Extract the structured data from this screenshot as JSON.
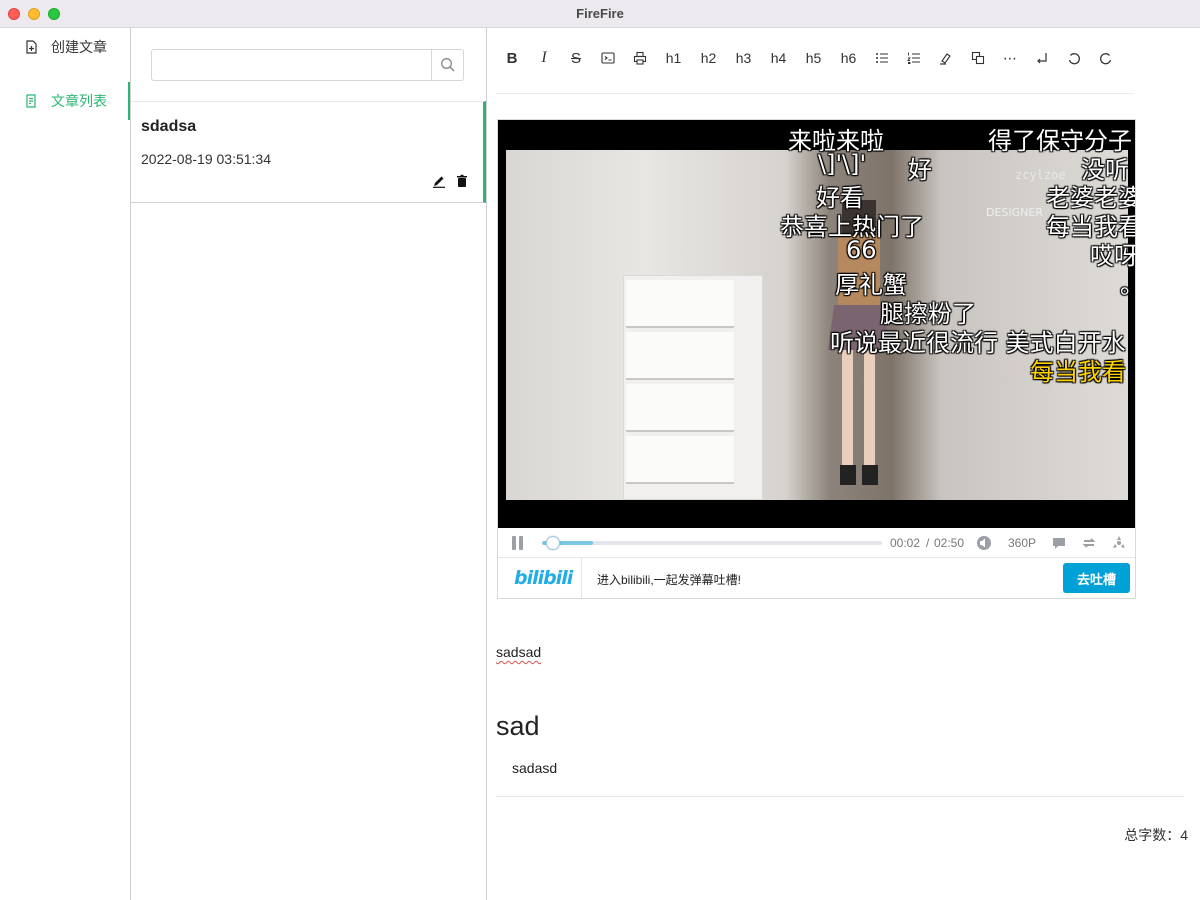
{
  "window": {
    "title": "FireFire"
  },
  "sidebar": {
    "items": [
      {
        "label": "创建文章",
        "icon": "new-file-icon",
        "active": false
      },
      {
        "label": "文章列表",
        "icon": "file-list-icon",
        "active": true
      }
    ]
  },
  "search": {
    "value": "",
    "placeholder": "",
    "icon": "search-icon"
  },
  "articles": [
    {
      "title": "sdadsa",
      "date": "2022-08-19 03:51:34",
      "actions": [
        "edit-icon",
        "delete-icon"
      ]
    }
  ],
  "toolbar": {
    "items": [
      {
        "name": "bold",
        "label": "B"
      },
      {
        "name": "italic",
        "label": "I"
      },
      {
        "name": "strikethrough",
        "label": "S"
      },
      {
        "name": "code",
        "label": ""
      },
      {
        "name": "print",
        "label": ""
      },
      {
        "name": "h1",
        "label": "h1"
      },
      {
        "name": "h2",
        "label": "h2"
      },
      {
        "name": "h3",
        "label": "h3"
      },
      {
        "name": "h4",
        "label": "h4"
      },
      {
        "name": "h5",
        "label": "h5"
      },
      {
        "name": "h6",
        "label": "h6"
      },
      {
        "name": "bullet-list",
        "label": ""
      },
      {
        "name": "ordered-list",
        "label": ""
      },
      {
        "name": "highlight",
        "label": ""
      },
      {
        "name": "copy",
        "label": ""
      },
      {
        "name": "more",
        "label": "⋯"
      },
      {
        "name": "line-break",
        "label": ""
      },
      {
        "name": "undo",
        "label": ""
      },
      {
        "name": "redo",
        "label": ""
      }
    ]
  },
  "player": {
    "danmaku": [
      {
        "text": "来啦来啦",
        "color": "#ffffff"
      },
      {
        "text": "得了保守分子",
        "color": "#ffffff"
      },
      {
        "text": "\\]'\\]'",
        "color": "#ffffff"
      },
      {
        "text": "好",
        "color": "#ffffff"
      },
      {
        "text": "没听",
        "color": "#ffffff"
      },
      {
        "text": "好看",
        "color": "#ffffff"
      },
      {
        "text": "老婆老婆",
        "color": "#ffffff"
      },
      {
        "text": "恭喜上热门了",
        "color": "#ffffff"
      },
      {
        "text": "每当我看",
        "color": "#ffffff"
      },
      {
        "text": "66",
        "color": "#ffffff"
      },
      {
        "text": "哎呀",
        "color": "#ffffff"
      },
      {
        "text": "厚礼蟹",
        "color": "#ffffff"
      },
      {
        "text": "。",
        "color": "#ffffff"
      },
      {
        "text": "腿擦粉了",
        "color": "#ffffff"
      },
      {
        "text": "听说最近很流行 美式白开水",
        "color": "#ffffff"
      },
      {
        "text": "每当我看",
        "color": "#ffd200"
      }
    ],
    "watermark": "zcylzoe",
    "designer_tag": "DESIGNER",
    "current_time": "00:02",
    "time_sep": "/",
    "duration": "02:50",
    "progress_fraction": 0.0118,
    "buffered_fraction": 0.15,
    "quality": "360P",
    "brand": "bilibili",
    "prompt_text": "进入bilibili,一起发弹幕吐槽!",
    "cta_label": "去吐槽",
    "accent_color": "#00a1d6"
  },
  "content": {
    "paragraph": "sadsad",
    "heading": "sad",
    "list_items": [
      "sadasd"
    ]
  },
  "footer": {
    "word_count": "总字数：4"
  },
  "colors": {
    "active": "#2bb673",
    "bili_blue": "#00a1d6"
  }
}
